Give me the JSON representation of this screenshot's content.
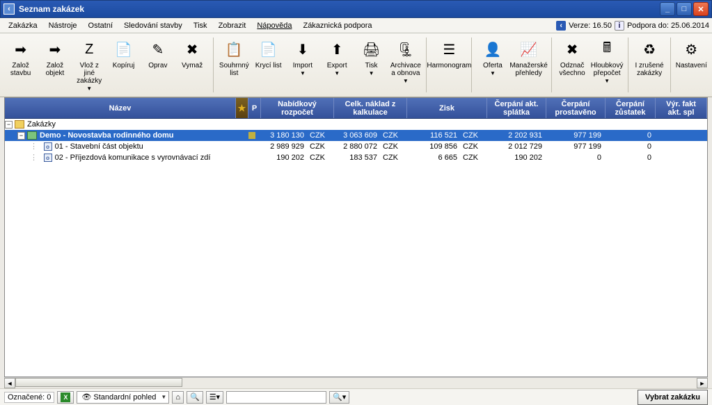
{
  "window": {
    "title": "Seznam zakázek"
  },
  "menu": {
    "items": [
      "Zakázka",
      "Nástroje",
      "Ostatní",
      "Sledování stavby",
      "Tisk",
      "Zobrazit",
      "Nápověda",
      "Zákaznická podpora"
    ],
    "underlinedIndex": 6,
    "verze_label": "Verze: 16.50",
    "podpora_label": "Podpora do: 25.06.2014"
  },
  "toolbar": [
    {
      "id": "zaloz-stavbu",
      "label": "Založ\nstavbu"
    },
    {
      "id": "zaloz-objekt",
      "label": "Založ\nobjekt"
    },
    {
      "id": "vloz-z-jine",
      "label": "Vlož z jiné\nzakázky",
      "dd": true
    },
    {
      "id": "kopiruj",
      "label": "Kopíruj"
    },
    {
      "id": "oprav",
      "label": "Oprav"
    },
    {
      "id": "vymaz",
      "label": "Vymaž"
    },
    {
      "sep": true
    },
    {
      "id": "souhrnny-list",
      "label": "Souhrnný\nlist"
    },
    {
      "id": "kryci-list",
      "label": "Krycí\nlist"
    },
    {
      "id": "import",
      "label": "Import",
      "dd": true
    },
    {
      "id": "export",
      "label": "Export",
      "dd": true
    },
    {
      "id": "tisk",
      "label": "Tisk",
      "dd": true
    },
    {
      "id": "archivace",
      "label": "Archivace\na obnova",
      "dd": true
    },
    {
      "sep": true
    },
    {
      "id": "harmonogram",
      "label": "Harmonogram"
    },
    {
      "sep": true
    },
    {
      "id": "oferta",
      "label": "Oferta",
      "dd": true
    },
    {
      "id": "manazerske",
      "label": "Manažerské\npřehledy"
    },
    {
      "sep": true
    },
    {
      "id": "odznac",
      "label": "Odznač\nvšechno"
    },
    {
      "id": "hloubkovy",
      "label": "Hloubkový\npřepočet",
      "dd": true
    },
    {
      "sep": true
    },
    {
      "id": "izrusene",
      "label": "I zrušené\nzakázky"
    },
    {
      "sep": true
    },
    {
      "id": "nastaveni",
      "label": "Nastavení"
    }
  ],
  "columns": {
    "name": "Název",
    "star": "★",
    "p": "P",
    "nab": "Nabídkový\nrozpočet",
    "celk": "Celk. náklad z\nkalkulace",
    "zisk": "Zisk",
    "cerp_akt": "Čerpání akt.\nsplátka",
    "cerp_pro": "Čerpání\nprostavěno",
    "cerp_zust": "Čerpání\nzůstatek",
    "vyr": "Výr. fakt\nakt. spl"
  },
  "tree": {
    "root": "Zakázky",
    "project": {
      "name": "Demo - Novostavba rodinného domu",
      "nab": "3 180 130",
      "nab_cur": "CZK",
      "celk": "3 063 609",
      "celk_cur": "CZK",
      "zisk": "116 521",
      "zisk_cur": "CZK",
      "c_akt": "2 202 931",
      "c_pro": "977 199",
      "c_zust": "0"
    },
    "children": [
      {
        "name": "01 - Stavební část objektu",
        "nab": "2 989 929",
        "nab_cur": "CZK",
        "celk": "2 880 072",
        "celk_cur": "CZK",
        "zisk": "109 856",
        "zisk_cur": "CZK",
        "c_akt": "2 012 729",
        "c_pro": "977 199",
        "c_zust": "0"
      },
      {
        "name": "02 - Příjezdová komunikace s vyrovnávací zdí",
        "nab": "190 202",
        "nab_cur": "CZK",
        "celk": "183 537",
        "celk_cur": "CZK",
        "zisk": "6 665",
        "zisk_cur": "CZK",
        "c_akt": "190 202",
        "c_pro": "0",
        "c_zust": "0"
      }
    ]
  },
  "status": {
    "oznacene": "Označené: 0",
    "pohled": "Standardní pohled",
    "vybrat": "Vybrat zakázku"
  }
}
